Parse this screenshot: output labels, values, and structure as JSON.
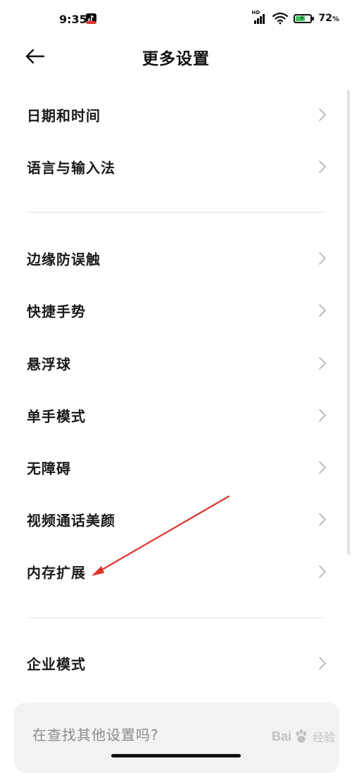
{
  "status_bar": {
    "time": "9:35",
    "network_badge": "HD",
    "battery_percent": "72",
    "battery_unit": "%",
    "battery_level": 0.72
  },
  "header": {
    "title": "更多设置"
  },
  "sections": [
    {
      "items": [
        {
          "label": "日期和时间"
        },
        {
          "label": "语言与输入法"
        }
      ]
    },
    {
      "items": [
        {
          "label": "边缘防误触"
        },
        {
          "label": "快捷手势"
        },
        {
          "label": "悬浮球"
        },
        {
          "label": "单手模式"
        },
        {
          "label": "无障碍"
        },
        {
          "label": "视频通话美颜"
        },
        {
          "label": "内存扩展"
        }
      ]
    },
    {
      "items": [
        {
          "label": "企业模式"
        }
      ]
    }
  ],
  "search_prompt": {
    "text": "在查找其他设置吗?"
  },
  "watermark": {
    "brand_left": "Bai",
    "brand_right": "经验"
  },
  "colors": {
    "annotation_arrow": "#e0342b",
    "battery_fill": "#3cc35a"
  }
}
